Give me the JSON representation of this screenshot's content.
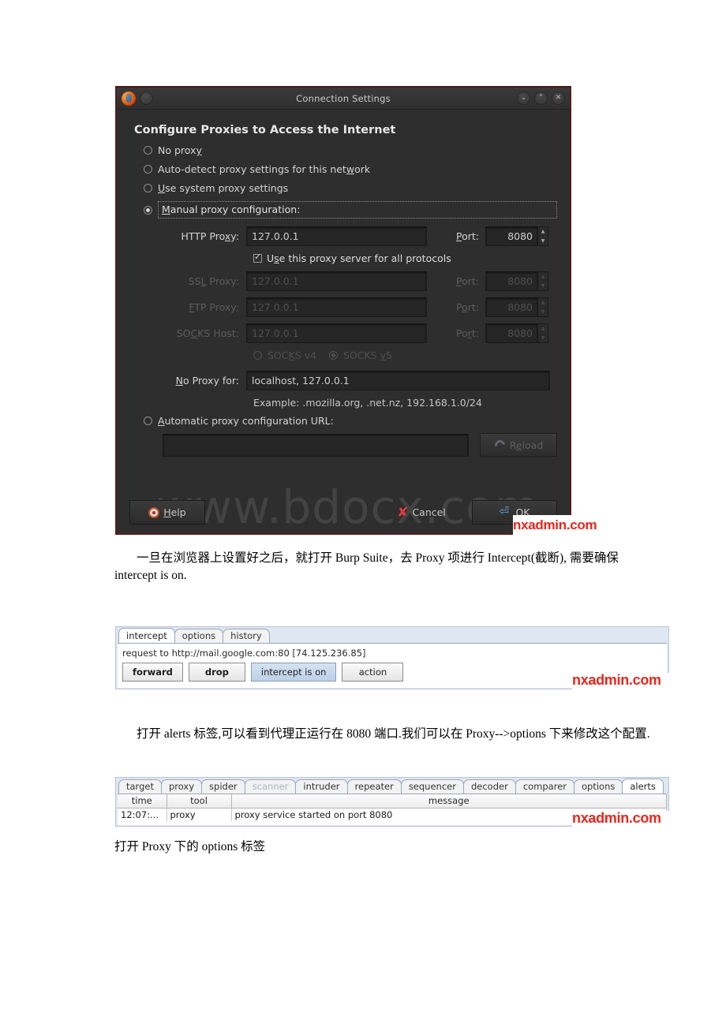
{
  "dialog": {
    "title": "Connection Settings",
    "heading": "Configure Proxies to Access the Internet",
    "window_controls": {
      "minimize": "⌄",
      "maximize": "⌃",
      "close": "✕"
    },
    "radios": [
      {
        "label_pre": "No prox",
        "label_key": "y",
        "label_post": "",
        "checked": false
      },
      {
        "label_pre": "Auto-detect proxy settings for this net",
        "label_key": "w",
        "label_post": "ork",
        "checked": false
      },
      {
        "label_pre": "",
        "label_key": "U",
        "label_post": "se system proxy settings",
        "checked": false
      }
    ],
    "manual": {
      "label_key": "M",
      "label_post": "anual proxy configuration:",
      "checked": true
    },
    "fields": [
      {
        "label": "HTTP Pro",
        "label_key": "x",
        "label_post": "y:",
        "value": "127.0.0.1",
        "port_label_pre": "",
        "port_key": "P",
        "port_label_post": "ort:",
        "port": "8080",
        "disabled": false
      },
      {
        "label": "SS",
        "label_key": "L",
        "label_post": " Proxy:",
        "value": "127.0.0.1",
        "port_label_pre": "",
        "port_key": "P",
        "port_label_post": "ort:",
        "port": "8080",
        "disabled": true
      },
      {
        "label": "",
        "label_key": "F",
        "label_post": "TP Proxy:",
        "value": "127.0.0.1",
        "port_label_pre": "P",
        "port_key": "o",
        "port_label_post": "rt:",
        "port": "8080",
        "disabled": true
      },
      {
        "label": "SO",
        "label_key": "C",
        "label_post": "KS Host:",
        "value": "127.0.0.1",
        "port_label_pre": "Po",
        "port_key": "r",
        "port_label_post": "t:",
        "port": "8080",
        "disabled": true
      }
    ],
    "all_protocols": {
      "pre": "U",
      "key": "s",
      "post": "e this proxy server for all protocols",
      "checked": true
    },
    "socks": [
      {
        "pre": "SOC",
        "key": "K",
        "post": "S v4",
        "checked": false
      },
      {
        "pre": "SOCKS ",
        "key": "v",
        "post": "5",
        "checked": true
      }
    ],
    "no_proxy": {
      "label_key": "N",
      "label_post": "o Proxy for:",
      "value": "localhost, 127.0.0.1"
    },
    "example": "Example: .mozilla.org, .net.nz, 192.168.1.0/24",
    "pac": {
      "label_key": "A",
      "label_post": "utomatic proxy configuration URL:",
      "checked": false,
      "value": ""
    },
    "reload_button": {
      "pre": "R",
      "key": "e",
      "post": "load"
    },
    "buttons": {
      "help": {
        "pre": "",
        "key": "H",
        "post": "elp"
      },
      "cancel": "Cancel",
      "ok": "OK"
    },
    "watermark": "www.bdocx.com"
  },
  "paragraphs": {
    "p1": "一旦在浏览器上设置好之后，就打开 Burp Suite，去 Proxy 项进行 Intercept(截断), 需要确保 intercept is on.",
    "p2": "打开 alerts 标签,可以看到代理正运行在 8080 端口.我们可以在 Proxy-->options 下来修改这个配置.",
    "p3": "打开 Proxy 下的 options 标签"
  },
  "burp_intercept": {
    "tabs": [
      {
        "label": "intercept",
        "selected": true,
        "disabled": false
      },
      {
        "label": "options",
        "selected": false,
        "disabled": false
      },
      {
        "label": "history",
        "selected": false,
        "disabled": false
      }
    ],
    "request_line": "request to http://mail.google.com:80  [74.125.236.85]",
    "buttons": [
      {
        "label": "forward",
        "style": "bold"
      },
      {
        "label": "drop",
        "style": "bold"
      },
      {
        "label": "intercept is on",
        "style": "toggle"
      },
      {
        "label": "action",
        "style": "plain"
      }
    ]
  },
  "burp_alerts": {
    "tabs": [
      {
        "label": "target",
        "selected": false,
        "disabled": false
      },
      {
        "label": "proxy",
        "selected": false,
        "disabled": false
      },
      {
        "label": "spider",
        "selected": false,
        "disabled": false
      },
      {
        "label": "scanner",
        "selected": false,
        "disabled": true
      },
      {
        "label": "intruder",
        "selected": false,
        "disabled": false
      },
      {
        "label": "repeater",
        "selected": false,
        "disabled": false
      },
      {
        "label": "sequencer",
        "selected": false,
        "disabled": false
      },
      {
        "label": "decoder",
        "selected": false,
        "disabled": false
      },
      {
        "label": "comparer",
        "selected": false,
        "disabled": false
      },
      {
        "label": "options",
        "selected": false,
        "disabled": false
      },
      {
        "label": "alerts",
        "selected": true,
        "disabled": false
      }
    ],
    "columns": [
      "time",
      "tool",
      "message"
    ],
    "rows": [
      {
        "time": "12:07:...",
        "tool": "proxy",
        "message": "proxy service started on port 8080"
      }
    ]
  },
  "badges": {
    "nx1": "nxadmin.com",
    "nx2": "nxadmin.com",
    "nx3": "nxadmin.com"
  },
  "colors": {
    "dialog_bg": "#2e2e2e",
    "dialog_border": "#5a1d1d",
    "badge_red": "#e8261c",
    "burp_panel_bg": "#dfe7f2",
    "toggle_blue": "#c9daee"
  }
}
